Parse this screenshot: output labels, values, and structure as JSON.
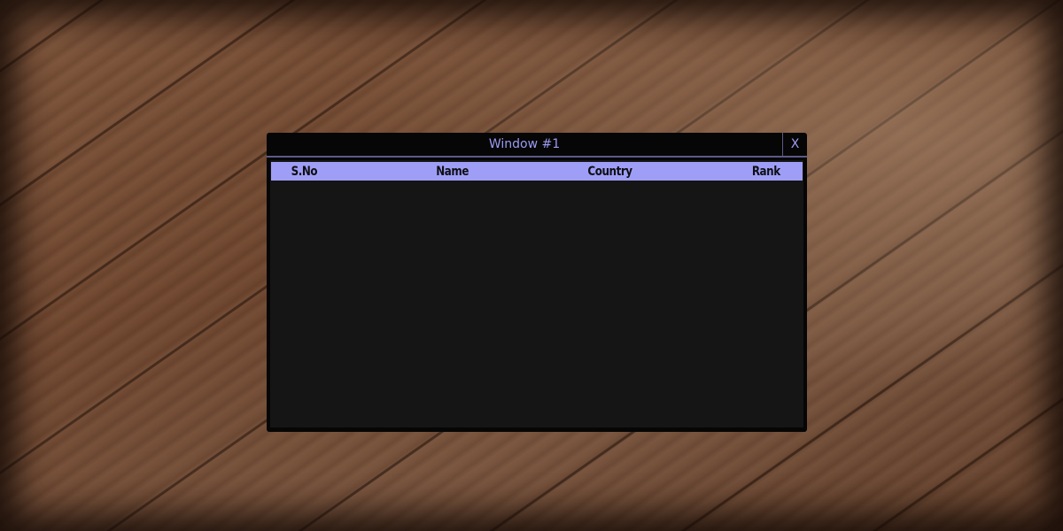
{
  "window": {
    "title": "Window #1",
    "close_label": "X"
  },
  "table": {
    "columns": [
      "S.No",
      "Name",
      "Country",
      "Rank"
    ],
    "rows": []
  },
  "colors": {
    "accent": "#9f9ef7",
    "title_text": "#9c9bf2",
    "window_bg": "#060606",
    "content_bg": "#151515"
  }
}
